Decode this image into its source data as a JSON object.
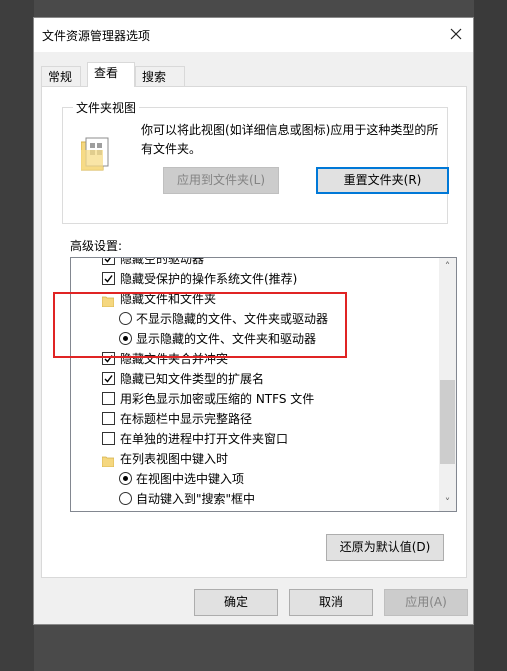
{
  "dialog": {
    "title": "文件资源管理器选项",
    "close_label": "×"
  },
  "tabs": [
    {
      "label": "常规"
    },
    {
      "label": "查看"
    },
    {
      "label": "搜索"
    }
  ],
  "folder_view": {
    "group_label": "文件夹视图",
    "description": "你可以将此视图(如详细信息或图标)应用于这种类型的所有文件夹。",
    "apply_button": "应用到文件夹(L)",
    "reset_button": "重置文件夹(R)"
  },
  "advanced": {
    "label": "高级设置:",
    "items": [
      {
        "type": "checkbox",
        "checked": true,
        "label": "隐藏空的驱动器"
      },
      {
        "type": "checkbox",
        "checked": true,
        "label": "隐藏受保护的操作系统文件(推荐)"
      },
      {
        "type": "folder",
        "label": "隐藏文件和文件夹"
      },
      {
        "type": "radio",
        "checked": false,
        "label": "不显示隐藏的文件、文件夹或驱动器"
      },
      {
        "type": "radio",
        "checked": true,
        "label": "显示隐藏的文件、文件夹和驱动器"
      },
      {
        "type": "checkbox",
        "checked": true,
        "label": "隐藏文件夹合并冲突"
      },
      {
        "type": "checkbox",
        "checked": true,
        "label": "隐藏已知文件类型的扩展名"
      },
      {
        "type": "checkbox",
        "checked": false,
        "label": "用彩色显示加密或压缩的 NTFS 文件"
      },
      {
        "type": "checkbox",
        "checked": false,
        "label": "在标题栏中显示完整路径"
      },
      {
        "type": "checkbox",
        "checked": false,
        "label": "在单独的进程中打开文件夹窗口"
      },
      {
        "type": "folder",
        "label": "在列表视图中键入时"
      },
      {
        "type": "radio",
        "checked": true,
        "label": "在视图中选中键入项"
      },
      {
        "type": "radio",
        "checked": false,
        "label": "自动键入到\"搜索\"框中"
      }
    ],
    "restore_button": "还原为默认值(D)"
  },
  "footer": {
    "ok": "确定",
    "cancel": "取消",
    "apply": "应用(A)"
  },
  "colors": {
    "highlight_border": "#e02424",
    "focus_border": "#0078d7"
  }
}
